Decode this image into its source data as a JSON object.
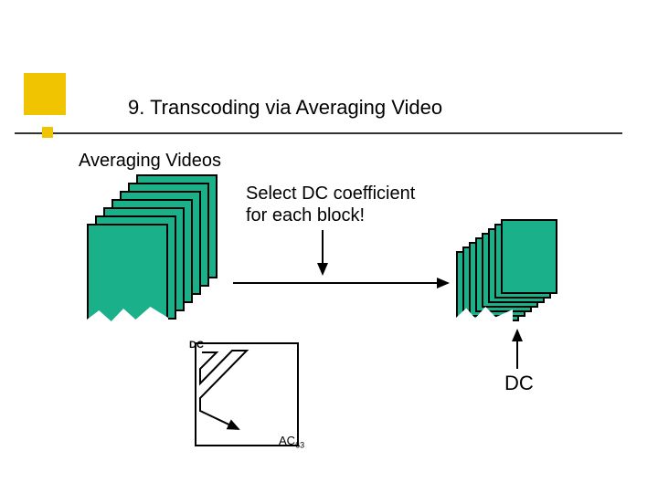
{
  "slide": {
    "title": "9. Transcoding via Averaging Video",
    "subtitle": "Averaging Videos",
    "select_line1": "Select DC coefficient",
    "select_line2": "for each block!",
    "dc_small": "DC",
    "ac_label": "AC",
    "ac_sub": "63",
    "dc_big": "DC",
    "accent_color": "#f0c400",
    "paper_color": "#19b08a"
  }
}
